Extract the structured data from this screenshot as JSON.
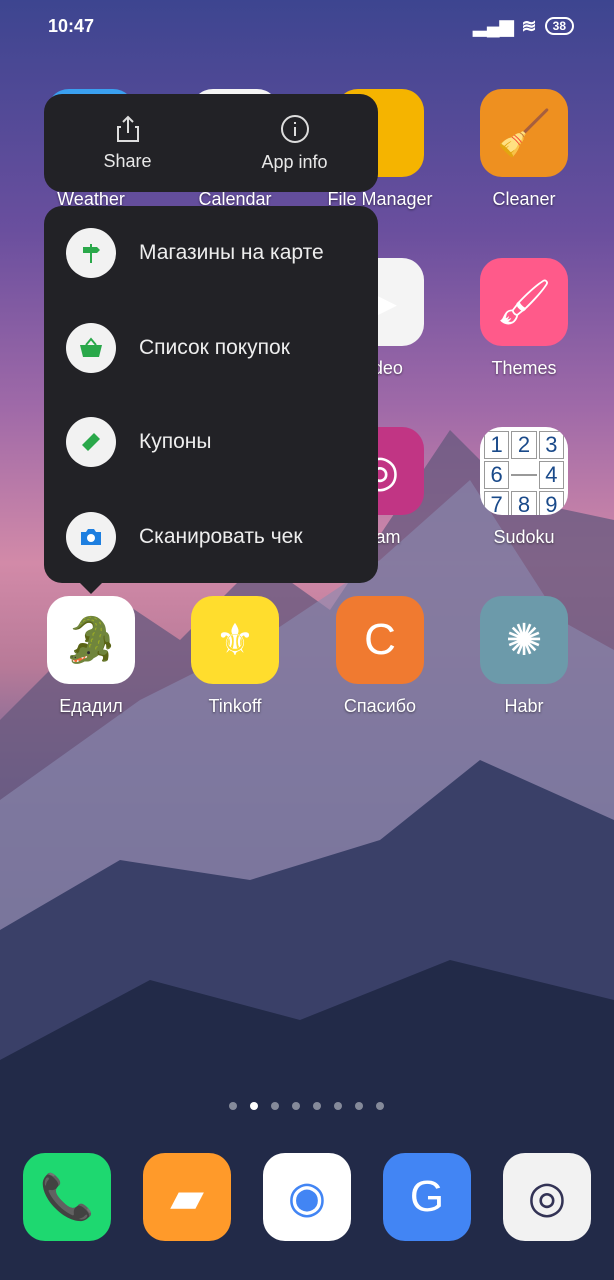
{
  "status": {
    "time": "10:47",
    "battery": "38"
  },
  "apps": [
    {
      "label": "Weather",
      "bg": "#3aa0f0",
      "glyph": "☀"
    },
    {
      "label": "Calendar",
      "bg": "#f4f4f4",
      "glyph": ""
    },
    {
      "label": "File Manager",
      "bg": "#f5b400",
      "glyph": ""
    },
    {
      "label": "Cleaner",
      "bg": "#ee9020",
      "glyph": "🧹"
    },
    {
      "label": "",
      "bg": "#fff",
      "glyph": ""
    },
    {
      "label": "",
      "bg": "#fff",
      "glyph": ""
    },
    {
      "label": "Video",
      "bg": "#f4f4f4",
      "glyph": "▶"
    },
    {
      "label": "Themes",
      "bg": "#ff5a8a",
      "glyph": "🖌"
    },
    {
      "label": "",
      "bg": "#fff",
      "glyph": ""
    },
    {
      "label": "",
      "bg": "#fff",
      "glyph": ""
    },
    {
      "label": "gram",
      "bg": "#c13584",
      "glyph": "◎"
    },
    {
      "label": "Sudoku",
      "bg": "#ffffff",
      "glyph": ""
    },
    {
      "label": "Едадил",
      "bg": "#ffffff",
      "glyph": "🐊"
    },
    {
      "label": "Tinkoff",
      "bg": "#ffdd2d",
      "glyph": "⚜"
    },
    {
      "label": "Спасибо",
      "bg": "#f07a30",
      "glyph": "C"
    },
    {
      "label": "Habr",
      "bg": "#6c9aaa",
      "glyph": "✺"
    }
  ],
  "sudoku": [
    "1",
    "2",
    "3",
    "6",
    "",
    "4",
    "7",
    "8",
    "9"
  ],
  "popup": {
    "share": "Share",
    "app_info": "App info"
  },
  "menu": [
    {
      "label": "Магазины на карте",
      "icon": "signpost-icon"
    },
    {
      "label": "Список покупок",
      "icon": "basket-icon"
    },
    {
      "label": "Купоны",
      "icon": "ticket-icon"
    },
    {
      "label": "Сканировать чек",
      "icon": "camera-icon"
    }
  ],
  "page_indicator": {
    "count": 8,
    "active": 2
  },
  "dock": [
    {
      "name": "phone",
      "bg": "#1ed870"
    },
    {
      "name": "messages",
      "bg": "#ff9a2a"
    },
    {
      "name": "chrome",
      "bg": "#ffffff"
    },
    {
      "name": "translate",
      "bg": "#4285f4"
    },
    {
      "name": "camera",
      "bg": "#f2f2f2"
    }
  ],
  "accent": "#2aa84a"
}
